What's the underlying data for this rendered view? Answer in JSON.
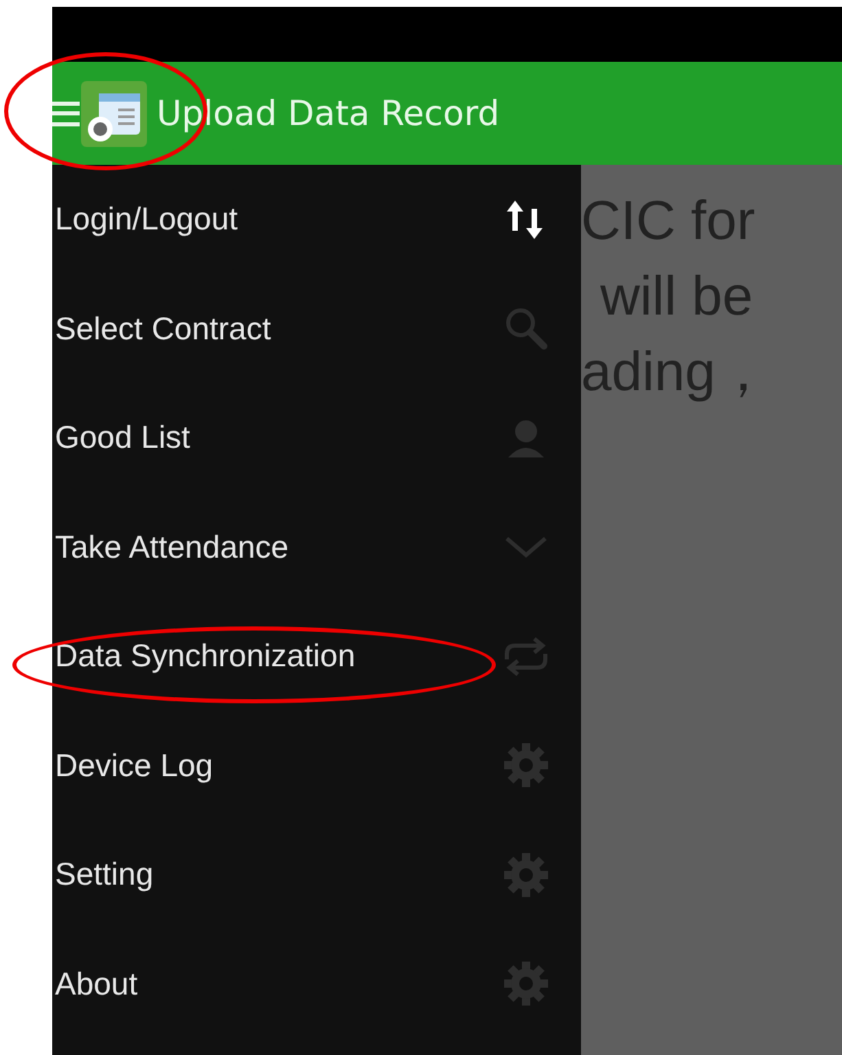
{
  "header": {
    "title": "Upload Data Record",
    "circled": true
  },
  "menu": {
    "items": [
      {
        "label": "Login/Logout",
        "kind": "updown",
        "selected": true,
        "circled": false
      },
      {
        "label": "Select Contract",
        "kind": "search",
        "selected": false,
        "circled": false
      },
      {
        "label": "Good List",
        "kind": "person",
        "selected": false,
        "circled": false
      },
      {
        "label": "Take Attendance",
        "kind": "chevron",
        "selected": false,
        "circled": false
      },
      {
        "label": "Data Synchronization",
        "kind": "repeat",
        "selected": false,
        "circled": true
      },
      {
        "label": "Device Log",
        "kind": "gear",
        "selected": false,
        "circled": false
      },
      {
        "label": "Setting",
        "kind": "gear",
        "selected": false,
        "circled": false
      },
      {
        "label": "About",
        "kind": "gear",
        "selected": false,
        "circled": false
      }
    ]
  },
  "content": {
    "lines": [
      "CIC for",
      "will be",
      "ading，"
    ]
  }
}
